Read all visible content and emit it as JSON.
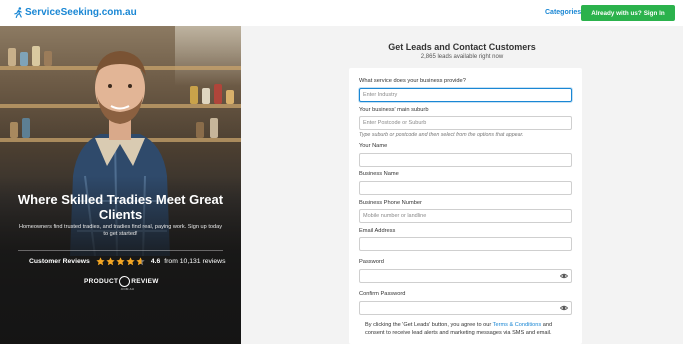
{
  "header": {
    "logo_text": "ServiceSeeking.com.au",
    "logo_icon": "runner-icon",
    "categories_label": "Categories",
    "signin_prefix": "Already with us?",
    "signin_label": "Sign In"
  },
  "hero": {
    "title": "Where Skilled Tradies Meet Great Clients",
    "subtitle": "Homeowners find trusted tradies, and tradies find real, paying work. Sign up today to get started!",
    "reviews_label": "Customer Reviews",
    "rating": "4.6",
    "rating_stars": 4.6,
    "reviews_count_text": "from 10,131 reviews",
    "review_logo_left": "PRODUCT",
    "review_logo_right": "REVIEW",
    "review_logo_sub": ".COM.AU"
  },
  "form": {
    "title": "Get Leads and Contact Customers",
    "subtitle": "2,865 leads available right now",
    "service_label": "What service does your business provide?",
    "service_placeholder": "Enter Industry",
    "suburb_label": "Your business' main suburb",
    "suburb_placeholder": "Enter Postcode or Suburb",
    "suburb_hint": "Type suburb or postcode and then select from the options that appear.",
    "name_label": "Your Name",
    "name_value": "",
    "business_label": "Business Name",
    "business_value": "",
    "phone_label": "Business Phone Number",
    "phone_placeholder": "Mobile number or landline",
    "email_label": "Email Address",
    "email_value": "",
    "password_label": "Password",
    "confirm_label": "Confirm Password",
    "consent_prefix": "By clicking the 'Get Leads' button, you agree to our",
    "consent_link": "Terms & Conditions",
    "consent_suffix": "and consent to receive lead alerts and marketing messages via SMS and email."
  },
  "colors": {
    "brand_blue": "#1a87d4",
    "brand_green": "#2bb24c",
    "star": "#f5a623"
  }
}
